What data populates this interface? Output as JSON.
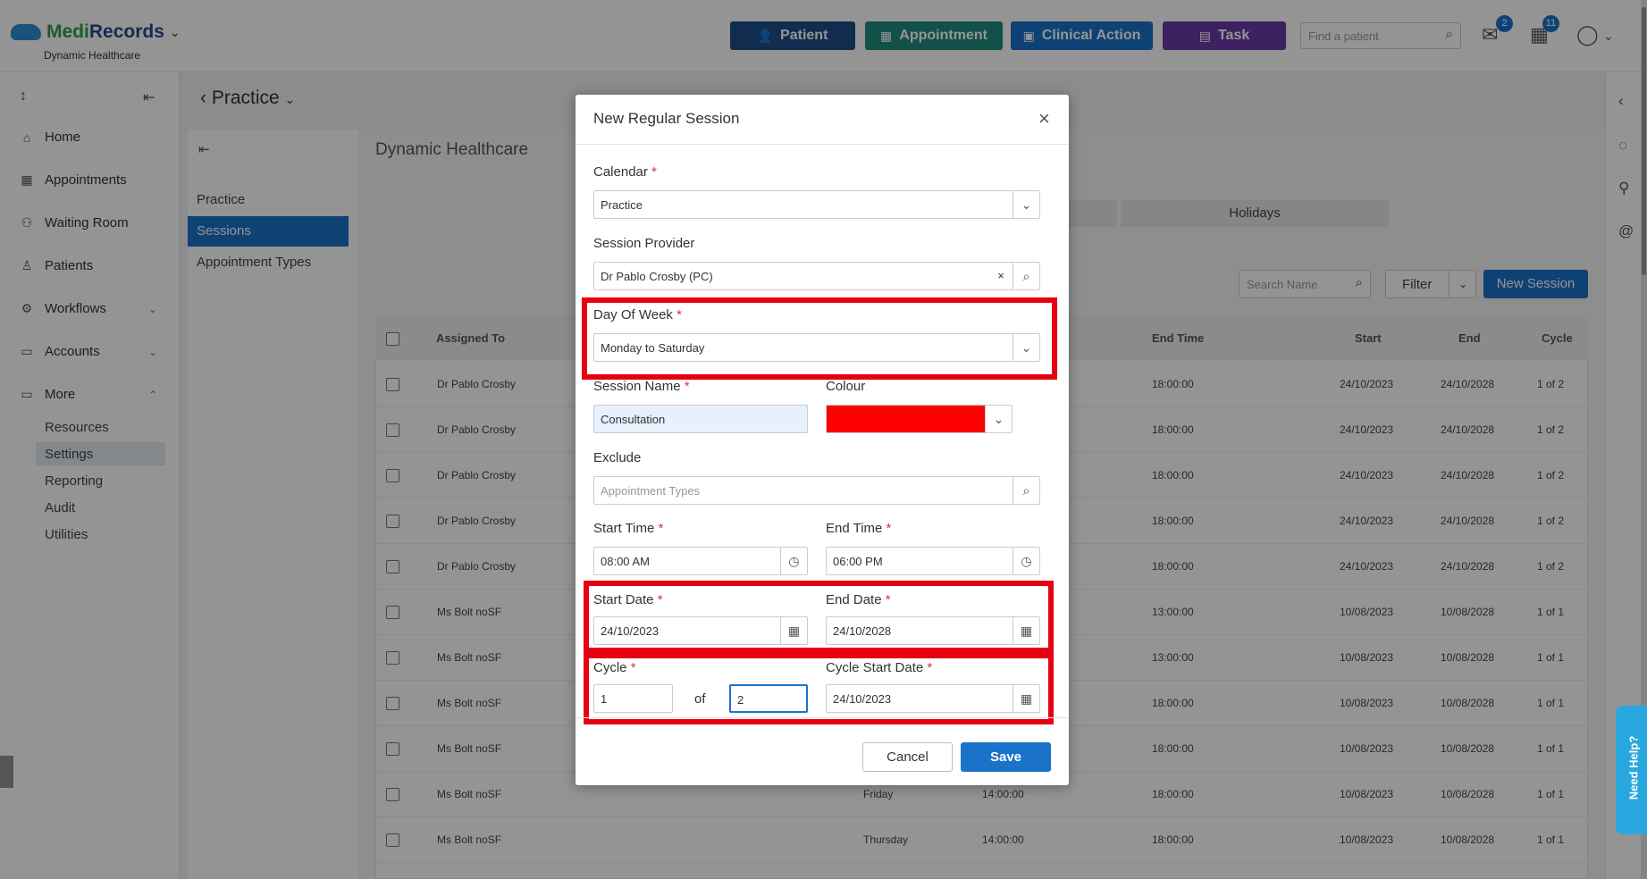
{
  "app": {
    "brand_a": "Medi",
    "brand_b": "Records",
    "org": "Dynamic Healthcare"
  },
  "header": {
    "buttons": [
      {
        "label": "Patient",
        "icon": "person-plus-icon",
        "color": "#1d4e89"
      },
      {
        "label": "Appointment",
        "icon": "calendar-icon",
        "color": "#1f8a7f"
      },
      {
        "label": "Clinical Action",
        "icon": "clinic-icon",
        "color": "#1a73c9"
      },
      {
        "label": "Task",
        "icon": "clipboard-icon",
        "color": "#6c3aa8"
      }
    ],
    "search_placeholder": "Find a patient",
    "mail_badge": "2",
    "tasks_badge": "11"
  },
  "sidebar": {
    "items": [
      {
        "label": "Home"
      },
      {
        "label": "Appointments"
      },
      {
        "label": "Waiting Room"
      },
      {
        "label": "Patients"
      },
      {
        "label": "Workflows"
      },
      {
        "label": "Accounts"
      },
      {
        "label": "More"
      }
    ],
    "sub_items": [
      {
        "label": "Resources"
      },
      {
        "label": "Settings"
      },
      {
        "label": "Reporting"
      },
      {
        "label": "Audit"
      },
      {
        "label": "Utilities"
      }
    ]
  },
  "page": {
    "breadcrumb": "Practice",
    "subnav": [
      "Practice",
      "Sessions",
      "Appointment Types"
    ],
    "title": "Dynamic Healthcare",
    "tab_holidays": "Holidays",
    "search_name_placeholder": "Search Name",
    "filter_label": "Filter",
    "new_session_label": "New Session"
  },
  "table": {
    "headers": {
      "assigned_to": "Assigned To",
      "end_time": "End Time",
      "start": "Start",
      "end": "End",
      "cycle": "Cycle"
    },
    "rows": [
      {
        "assigned": "Dr Pablo Crosby",
        "day": "",
        "start_time": "",
        "end_time": "18:00:00",
        "start": "24/10/2023",
        "end": "24/10/2028",
        "cycle": "1 of 2"
      },
      {
        "assigned": "Dr Pablo Crosby",
        "day": "",
        "start_time": "",
        "end_time": "18:00:00",
        "start": "24/10/2023",
        "end": "24/10/2028",
        "cycle": "1 of 2"
      },
      {
        "assigned": "Dr Pablo Crosby",
        "day": "",
        "start_time": "",
        "end_time": "18:00:00",
        "start": "24/10/2023",
        "end": "24/10/2028",
        "cycle": "1 of 2"
      },
      {
        "assigned": "Dr Pablo Crosby",
        "day": "",
        "start_time": "",
        "end_time": "18:00:00",
        "start": "24/10/2023",
        "end": "24/10/2028",
        "cycle": "1 of 2"
      },
      {
        "assigned": "Dr Pablo Crosby",
        "day": "",
        "start_time": "",
        "end_time": "18:00:00",
        "start": "24/10/2023",
        "end": "24/10/2028",
        "cycle": "1 of 2"
      },
      {
        "assigned": "Ms Bolt noSF",
        "day": "",
        "start_time": "",
        "end_time": "13:00:00",
        "start": "10/08/2023",
        "end": "10/08/2028",
        "cycle": "1 of 1"
      },
      {
        "assigned": "Ms Bolt noSF",
        "day": "",
        "start_time": "",
        "end_time": "13:00:00",
        "start": "10/08/2023",
        "end": "10/08/2028",
        "cycle": "1 of 1"
      },
      {
        "assigned": "Ms Bolt noSF",
        "day": "",
        "start_time": "",
        "end_time": "18:00:00",
        "start": "10/08/2023",
        "end": "10/08/2028",
        "cycle": "1 of 1"
      },
      {
        "assigned": "Ms Bolt noSF",
        "day": "",
        "start_time": "",
        "end_time": "18:00:00",
        "start": "10/08/2023",
        "end": "10/08/2028",
        "cycle": "1 of 1"
      },
      {
        "assigned": "Ms Bolt noSF",
        "day": "Friday",
        "start_time": "14:00:00",
        "end_time": "18:00:00",
        "start": "10/08/2023",
        "end": "10/08/2028",
        "cycle": "1 of 1"
      },
      {
        "assigned": "Ms Bolt noSF",
        "day": "Thursday",
        "start_time": "14:00:00",
        "end_time": "18:00:00",
        "start": "10/08/2023",
        "end": "10/08/2028",
        "cycle": "1 of 1"
      }
    ]
  },
  "modal": {
    "title": "New Regular Session",
    "close_glyph": "×",
    "calendar_label": "Calendar",
    "calendar_value": "Practice",
    "provider_label": "Session Provider",
    "provider_value": "Dr Pablo Crosby (PC)",
    "clear_glyph": "×",
    "day_label": "Day Of Week",
    "day_value": "Monday to Saturday",
    "session_name_label": "Session Name",
    "session_name_value": "Consultation",
    "colour_label": "Colour",
    "colour_value": "#ff0000",
    "exclude_label": "Exclude",
    "exclude_placeholder": "Appointment Types",
    "start_time_label": "Start Time",
    "start_time_value": "08:00 AM",
    "end_time_label": "End Time",
    "end_time_value": "06:00 PM",
    "start_date_label": "Start Date",
    "start_date_value": "24/10/2023",
    "end_date_label": "End Date",
    "end_date_value": "24/10/2028",
    "cycle_label": "Cycle",
    "cycle_value": "1",
    "cycle_of": "of",
    "cycle_total_value": "2",
    "cycle_start_label": "Cycle Start Date",
    "cycle_start_value": "24/10/2023",
    "required_mark": "*",
    "cancel_label": "Cancel",
    "save_label": "Save"
  },
  "help_label": "Need Help?",
  "highlight_color": "#e60012"
}
